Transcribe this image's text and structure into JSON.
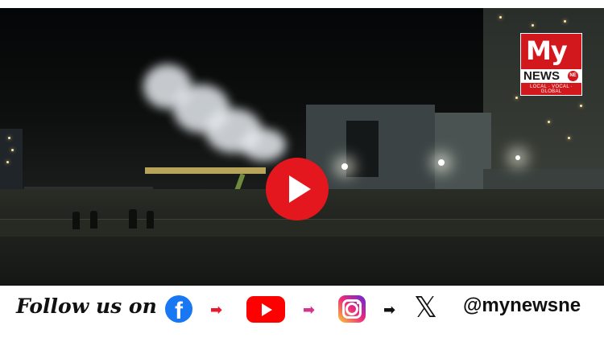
{
  "video": {
    "play_label": "Play video"
  },
  "logo": {
    "brand_top": "My",
    "brand_bottom": "NEWS",
    "badge": "NE",
    "tagline": "LOCAL · VOCAL · GLOBAL"
  },
  "follow": {
    "text": "Follow us on",
    "handle": "@mynewsne",
    "platforms": [
      "facebook-icon",
      "youtube-icon",
      "instagram-icon",
      "x-icon"
    ],
    "arrow_colors": [
      "#e8192c",
      "#d6338c",
      "#111111"
    ]
  },
  "colors": {
    "brand_red": "#d2171d",
    "play_red": "#e4171f",
    "facebook": "#1877f2",
    "youtube": "#ff0000"
  }
}
